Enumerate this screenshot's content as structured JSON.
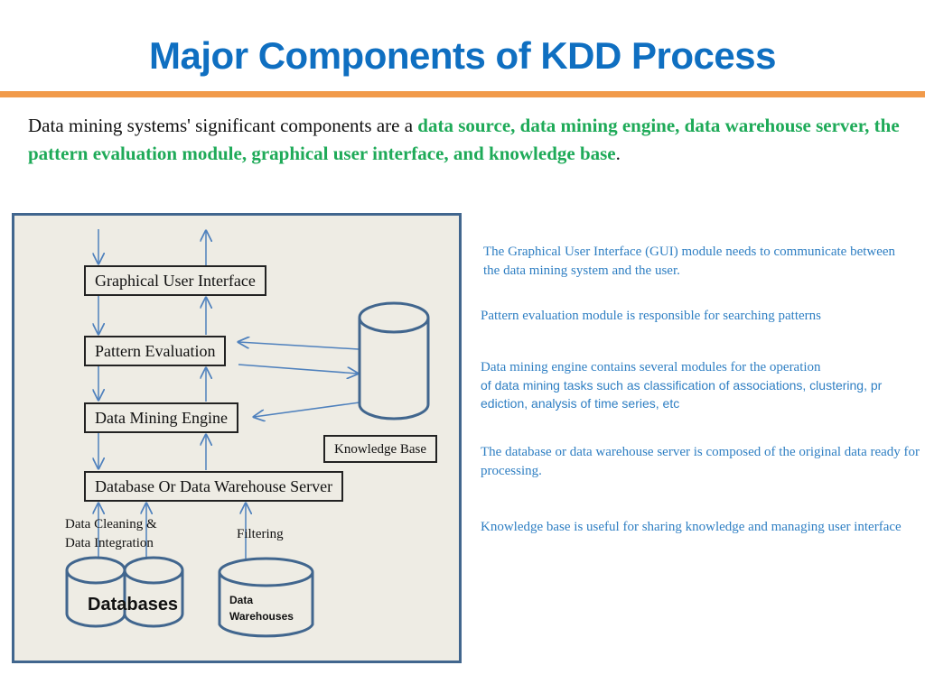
{
  "slide": {
    "title": "Major Components of KDD Process",
    "accent_color": "#f19a4a",
    "title_color": "#0f6fc1",
    "highlight_color": "#1eaa58"
  },
  "intro": {
    "plain": "Data mining systems' significant components are a ",
    "highlight": "data source, data mining engine, data warehouse server, the pattern evaluation module, graphical user interface, and knowledge base",
    "end": "."
  },
  "diagram": {
    "boxes": {
      "gui": "Graphical User Interface",
      "pattern": "Pattern Evaluation",
      "engine": "Data Mining Engine",
      "knowledge": "Knowledge Base",
      "server": "Database Or Data Warehouse Server"
    },
    "labels": {
      "cleaning_line1": "Data Cleaning &",
      "cleaning_line2": "Data Integration",
      "filtering": "Filtering",
      "databases": "Databases",
      "warehouses_line1": "Data",
      "warehouses_line2": "Warehouses"
    }
  },
  "descriptions": {
    "gui": "The Graphical User Interface (GUI) module needs to communicate between the data mining system and the user.",
    "pattern": "Pattern evaluation module is responsible for searching patterns",
    "engine_line1": "Data mining engine contains several modules for the operation",
    "engine_line2": "of data mining tasks such as classification of associations, clustering, pr",
    "engine_line3": "ediction, analysis of time series, etc",
    "server": "The database or data warehouse server is composed of the original data ready for processing.",
    "knowledge": "Knowledge base is useful for sharing knowledge and managing user interface"
  }
}
